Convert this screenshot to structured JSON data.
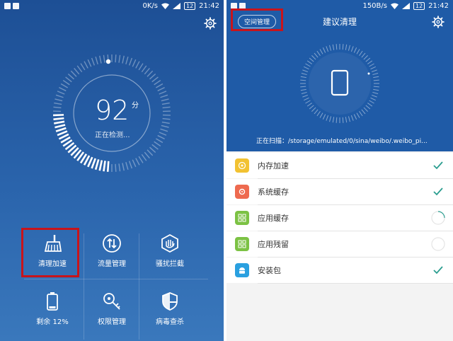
{
  "left_screen": {
    "status_bar": {
      "speed": "0K/s",
      "battery": "12",
      "time": "21:42"
    },
    "settings_icon": "gear-icon",
    "score": {
      "value": "92",
      "unit": "分",
      "status": "正在检测..."
    },
    "tools": [
      {
        "label": "清理加速",
        "icon": "broom-icon"
      },
      {
        "label": "流量管理",
        "icon": "traffic-icon"
      },
      {
        "label": "骚扰拦截",
        "icon": "block-hand-icon"
      },
      {
        "label": "剩余 12%",
        "icon": "battery-icon"
      },
      {
        "label": "权限管理",
        "icon": "key-icon"
      },
      {
        "label": "病毒查杀",
        "icon": "shield-icon"
      }
    ],
    "highlight_color": "#c8141b",
    "accent": "#1d4f95"
  },
  "right_screen": {
    "status_bar": {
      "speed": "150B/s",
      "battery": "12",
      "time": "21:42"
    },
    "header": {
      "chip_label": "空间管理",
      "title": "建议清理"
    },
    "settings_icon": "gear-icon",
    "scan_text": "正在扫描：/storage/emulated/0/sina/weibo/.weibo_pi...",
    "items": [
      {
        "name": "内存加速",
        "icon": "memory-icon",
        "icon_color": "#f2c232",
        "state": "done"
      },
      {
        "name": "系统缓存",
        "icon": "gear-icon",
        "icon_color": "#ee6a4f",
        "state": "done"
      },
      {
        "name": "应用缓存",
        "icon": "app-grid-icon",
        "icon_color": "#7cc244",
        "state": "scanning"
      },
      {
        "name": "应用残留",
        "icon": "app-grid-icon",
        "icon_color": "#7cc244",
        "state": "scanning"
      },
      {
        "name": "安装包",
        "icon": "android-icon",
        "icon_color": "#2aa0e0",
        "state": "done"
      }
    ],
    "check_color": "#2a9d8f"
  }
}
